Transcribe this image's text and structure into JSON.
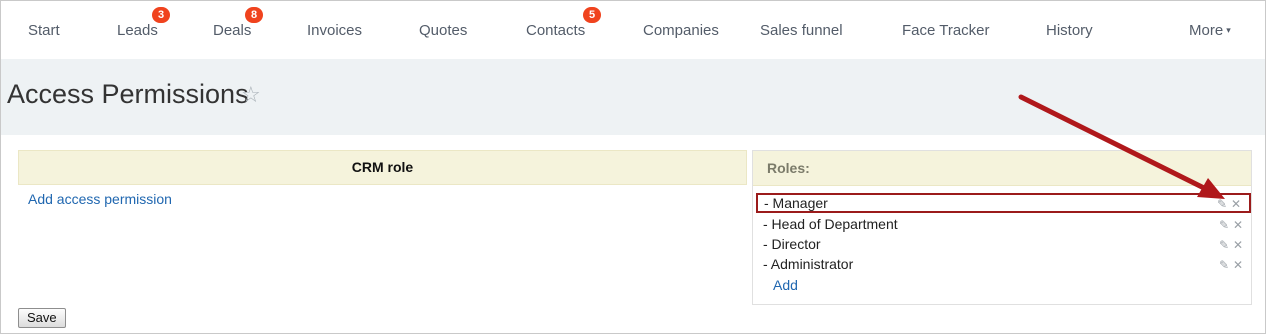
{
  "nav": {
    "items": [
      {
        "label": "Start",
        "badge": ""
      },
      {
        "label": "Leads",
        "badge": "3"
      },
      {
        "label": "Deals",
        "badge": "8"
      },
      {
        "label": "Invoices",
        "badge": ""
      },
      {
        "label": "Quotes",
        "badge": ""
      },
      {
        "label": "Contacts",
        "badge": "5"
      },
      {
        "label": "Companies",
        "badge": ""
      },
      {
        "label": "Sales funnel",
        "badge": ""
      },
      {
        "label": "Face Tracker",
        "badge": ""
      },
      {
        "label": "History",
        "badge": ""
      },
      {
        "label": "More",
        "badge": ""
      }
    ],
    "more_caret": "▾"
  },
  "header": {
    "title": "Access Permissions",
    "star_icon": "☆"
  },
  "permissions": {
    "column_header": "CRM role",
    "add_link": "Add access permission"
  },
  "roles": {
    "header": "Roles:",
    "items": [
      {
        "label": "- Manager",
        "highlighted": true
      },
      {
        "label": "- Head of Department",
        "highlighted": false
      },
      {
        "label": "- Director",
        "highlighted": false
      },
      {
        "label": "- Administrator",
        "highlighted": false
      }
    ],
    "edit_icon": "✎",
    "delete_icon": "✕",
    "add_label": "Add"
  },
  "footer": {
    "save_label": "Save"
  },
  "colors": {
    "badge": "#f0431e",
    "link": "#2067b0",
    "annotation_arrow": "#b0181b",
    "header_band": "#eef2f4",
    "table_header": "#f5f3dc"
  }
}
